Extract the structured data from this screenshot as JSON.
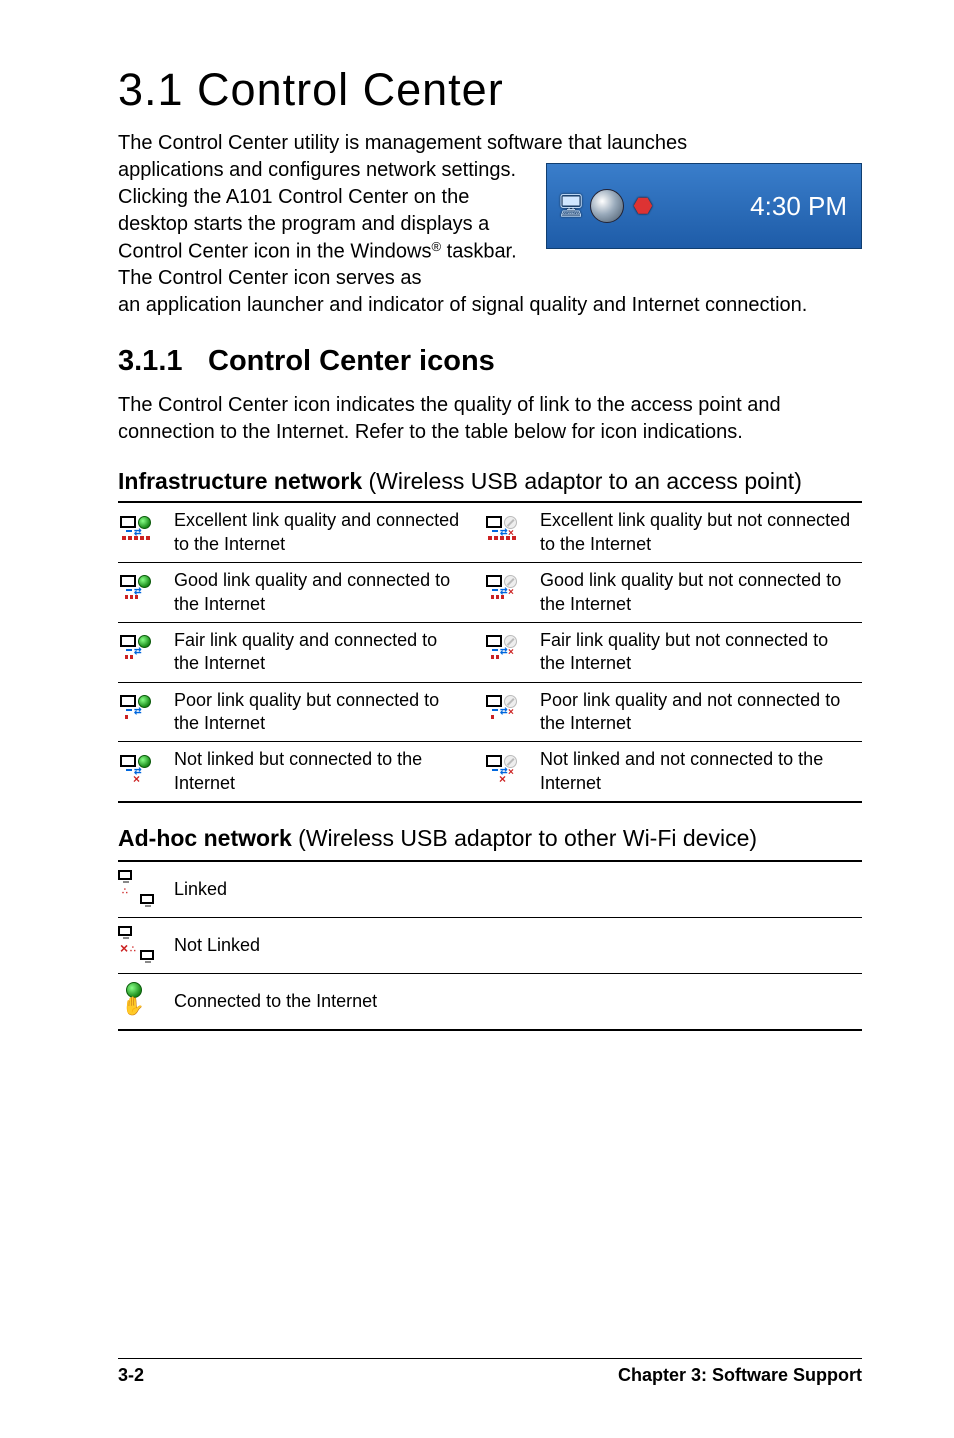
{
  "page": {
    "h1": "3.1  Control Center",
    "intro_full": "The Control Center utility is management software that launches",
    "intro_part1": "applications and configures network settings. Clicking the A101 Control Center on the desktop starts the program and displays a Control Center icon in the Windows",
    "intro_sup": "®",
    "intro_part2": " taskbar. The Control Center icon serves as",
    "intro_after": "an application launcher and indicator of signal quality and Internet connection.",
    "h2_num": "3.1.1",
    "h2_text": "Control Center icons",
    "sec_body": "The Control Center icon indicates the quality of link to the access point and connection to the Internet. Refer to the table below for icon indications.",
    "h3_infra_bold": "Infrastructure network",
    "h3_infra_paren": " (Wireless USB adaptor to an access point)",
    "h3_adhoc_bold": "Ad-hoc network",
    "h3_adhoc_paren": " (Wireless USB adaptor to other Wi-Fi device)"
  },
  "taskbar": {
    "time": "4:30 PM"
  },
  "infra_table": {
    "r0": {
      "left": "Excellent link quality and connected to the Internet",
      "right": "Excellent link quality but not connected to the Internet"
    },
    "r1": {
      "left": "Good link quality and connected to the Internet",
      "right": "Good link quality but not connected to the Internet"
    },
    "r2": {
      "left": "Fair link quality and connected to the Internet",
      "right": "Fair link quality but not connected to the Internet"
    },
    "r3": {
      "left": "Poor link quality but connected to the Internet",
      "right": "Poor link quality and not connected to the Internet"
    },
    "r4": {
      "left": "Not linked but connected to the Internet",
      "right": "Not linked and not connected to the Internet"
    }
  },
  "adhoc_table": {
    "r0": "Linked",
    "r1": "Not Linked",
    "r2": "Connected to the Internet"
  },
  "footer": {
    "left": "3-2",
    "right": "Chapter 3: Software Support"
  }
}
